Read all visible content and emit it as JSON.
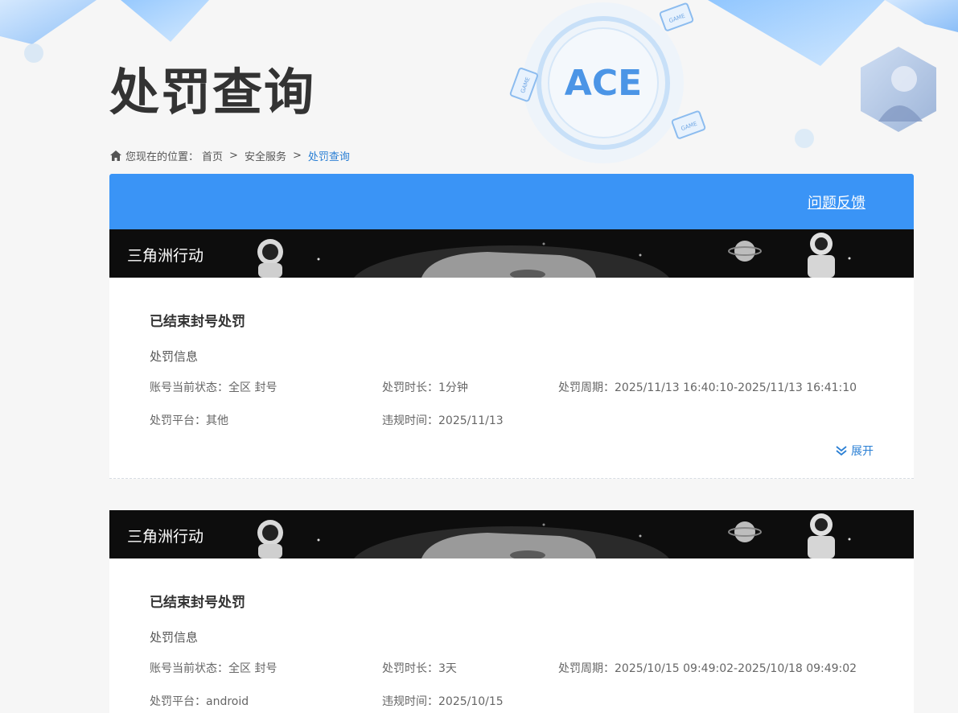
{
  "page": {
    "title": "处罚查询"
  },
  "breadcrumb": {
    "prefix": "您现在的位置：",
    "items": [
      "首页",
      "安全服务",
      "处罚查询"
    ]
  },
  "header": {
    "feedback_label": "问题反馈",
    "logo_text": "ACE",
    "badge_text": "GAME"
  },
  "records": [
    {
      "game": "三角洲行动",
      "title": "已结束封号处罚",
      "info_label": "处罚信息",
      "status": "账号当前状态：全区 封号",
      "duration": "处罚时长：1分钟",
      "period": "处罚周期：2025/11/13 16:40:10-2025/11/13 16:41:10",
      "platform": "处罚平台：其他",
      "violation_time": "违规时间：2025/11/13",
      "expand_label": "展开"
    },
    {
      "game": "三角洲行动",
      "title": "已结束封号处罚",
      "info_label": "处罚信息",
      "status": "账号当前状态：全区 封号",
      "duration": "处罚时长：3天",
      "period": "处罚周期：2025/10/15 09:49:02-2025/10/18 09:49:02",
      "platform": "处罚平台：android",
      "violation_time": "违规时间：2025/10/15"
    }
  ],
  "colors": {
    "accent": "#3a94f6",
    "link": "#2a7fd4",
    "banner": "#0d0d0d"
  }
}
